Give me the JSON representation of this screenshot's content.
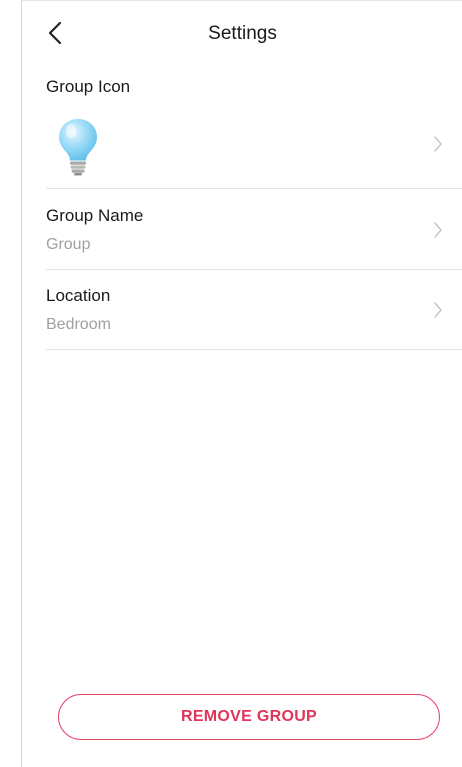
{
  "header": {
    "title": "Settings",
    "back_icon": "chevron-left-icon"
  },
  "group_icon": {
    "label": "Group Icon",
    "icon": "light-bulb-icon",
    "accent_color": "#8fd3f4"
  },
  "group_name": {
    "label": "Group Name",
    "value": "Group"
  },
  "location": {
    "label": "Location",
    "value": "Bedroom"
  },
  "actions": {
    "remove_label": "REMOVE GROUP",
    "remove_color": "#e0355b"
  }
}
